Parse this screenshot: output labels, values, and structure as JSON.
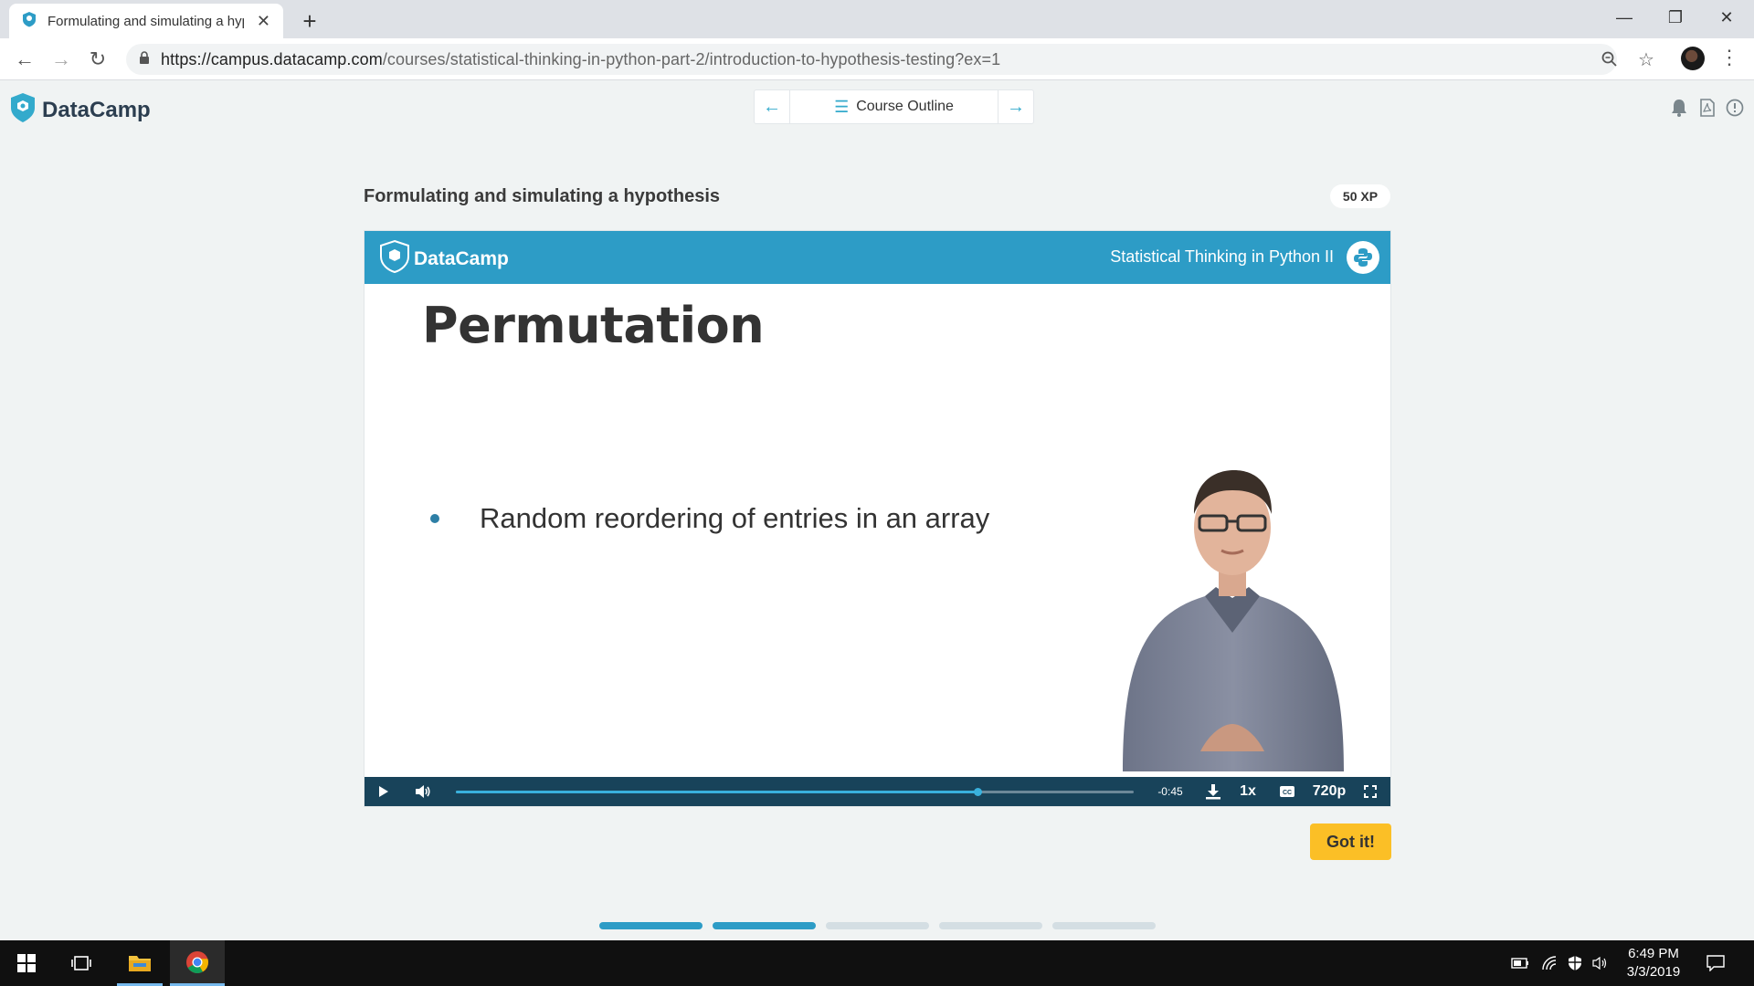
{
  "browser": {
    "tab_title": "Formulating and simulating a hypothesis",
    "tab_close": "✕",
    "new_tab": "+",
    "url_host": "https://campus.datacamp.com",
    "url_path": "/courses/statistical-thinking-in-python-part-2/introduction-to-hypothesis-testing?ex=1",
    "window_controls": {
      "minimize": "—",
      "restore": "❐",
      "close": "✕"
    }
  },
  "header": {
    "logo_text": "DataCamp",
    "course_outline_label": "Course Outline",
    "prev_arrow": "←",
    "next_arrow": "→",
    "icons": [
      "bell-icon",
      "pdf-icon",
      "info-icon"
    ]
  },
  "exercise": {
    "title": "Formulating and simulating a hypothesis",
    "xp": "50 XP",
    "got_it_label": "Got it!"
  },
  "video": {
    "logo_text": "DataCamp",
    "course_name": "Statistical Thinking in Python II",
    "slide_title": "Permutation",
    "bullet": "Random reordering of entries in an array",
    "controls": {
      "time_remaining": "-0:45",
      "speed": "1x",
      "quality": "720p",
      "progress": 0.77
    }
  },
  "progress_steps": [
    {
      "state": "done"
    },
    {
      "state": "done"
    },
    {
      "state": "todo"
    },
    {
      "state": "todo"
    },
    {
      "state": "todo"
    }
  ],
  "colors": {
    "brand": "#2d9cc6",
    "accent_button": "#fbbf26",
    "step_done": "#2d9cc6",
    "step_todo": "#d4dee3",
    "controls_bg": "#18435a"
  },
  "taskbar": {
    "time": "6:49 PM",
    "date": "3/3/2019"
  }
}
